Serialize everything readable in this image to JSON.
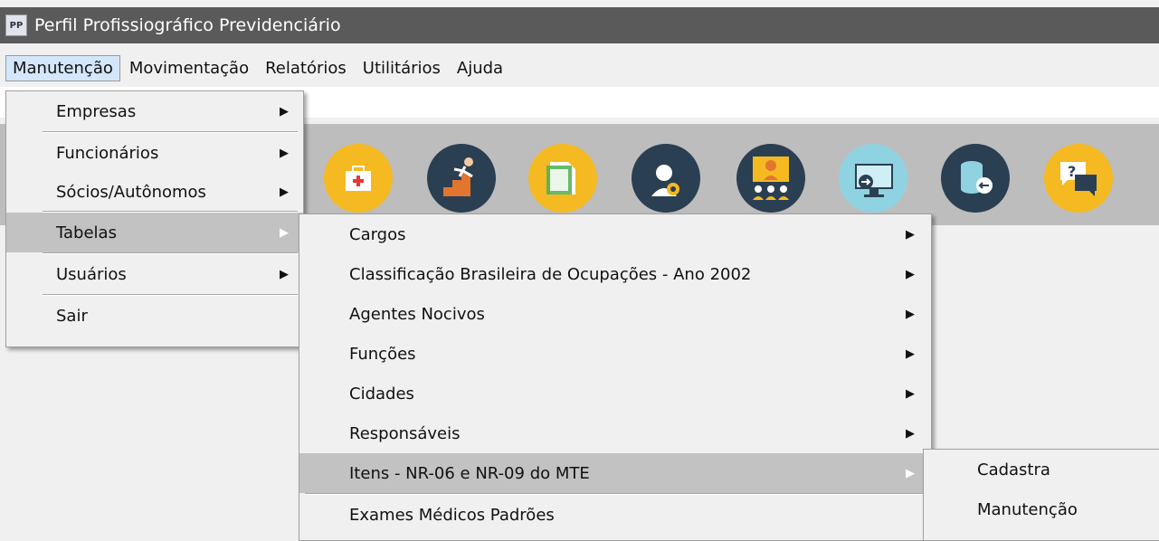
{
  "window": {
    "icon_text": "PP",
    "title": "Perfil Profissiográfico Previdenciário"
  },
  "menubar": {
    "items": [
      {
        "label": "Manutenção"
      },
      {
        "label": "Movimentação"
      },
      {
        "label": "Relatórios"
      },
      {
        "label": "Utilitários"
      },
      {
        "label": "Ajuda"
      }
    ]
  },
  "manutencao_menu": {
    "items": [
      {
        "label": "Empresas"
      },
      {
        "label": "Funcionários"
      },
      {
        "label": "Sócios/Autônomos"
      },
      {
        "label": "Tabelas"
      },
      {
        "label": "Usuários"
      },
      {
        "label": "Sair"
      }
    ]
  },
  "tabelas_menu": {
    "items": [
      {
        "label": "Cargos"
      },
      {
        "label": "Classificação Brasileira de Ocupações - Ano 2002"
      },
      {
        "label": "Agentes Nocivos"
      },
      {
        "label": "Funções"
      },
      {
        "label": "Cidades"
      },
      {
        "label": "Responsáveis"
      },
      {
        "label": "Itens - NR-06 e NR-09 do MTE"
      },
      {
        "label": "Exames Médicos Padrões"
      }
    ]
  },
  "itens_menu": {
    "items": [
      {
        "label": "Cadastra"
      },
      {
        "label": "Manutenção"
      }
    ]
  },
  "toolbar": {
    "icons": [
      {
        "name": "first-aid-kit-icon",
        "color": "#f5b921"
      },
      {
        "name": "person-falling-stairs-icon",
        "color": "#2b3f52"
      },
      {
        "name": "document-page-icon",
        "color": "#f5b921"
      },
      {
        "name": "support-agent-gear-icon",
        "color": "#2b3f52"
      },
      {
        "name": "presentation-audience-icon",
        "color": "#2b3f52"
      },
      {
        "name": "monitor-arrow-icon",
        "color": "#8fd3e3"
      },
      {
        "name": "database-arrow-icon",
        "color": "#2b3f52"
      },
      {
        "name": "help-chat-icon",
        "color": "#f5b921"
      }
    ]
  },
  "colors": {
    "titlebar": "#5a5a5a",
    "toolbar": "#bdbdbd",
    "menu_bg": "#f0f0f0",
    "highlight": "#c2c2c2"
  }
}
